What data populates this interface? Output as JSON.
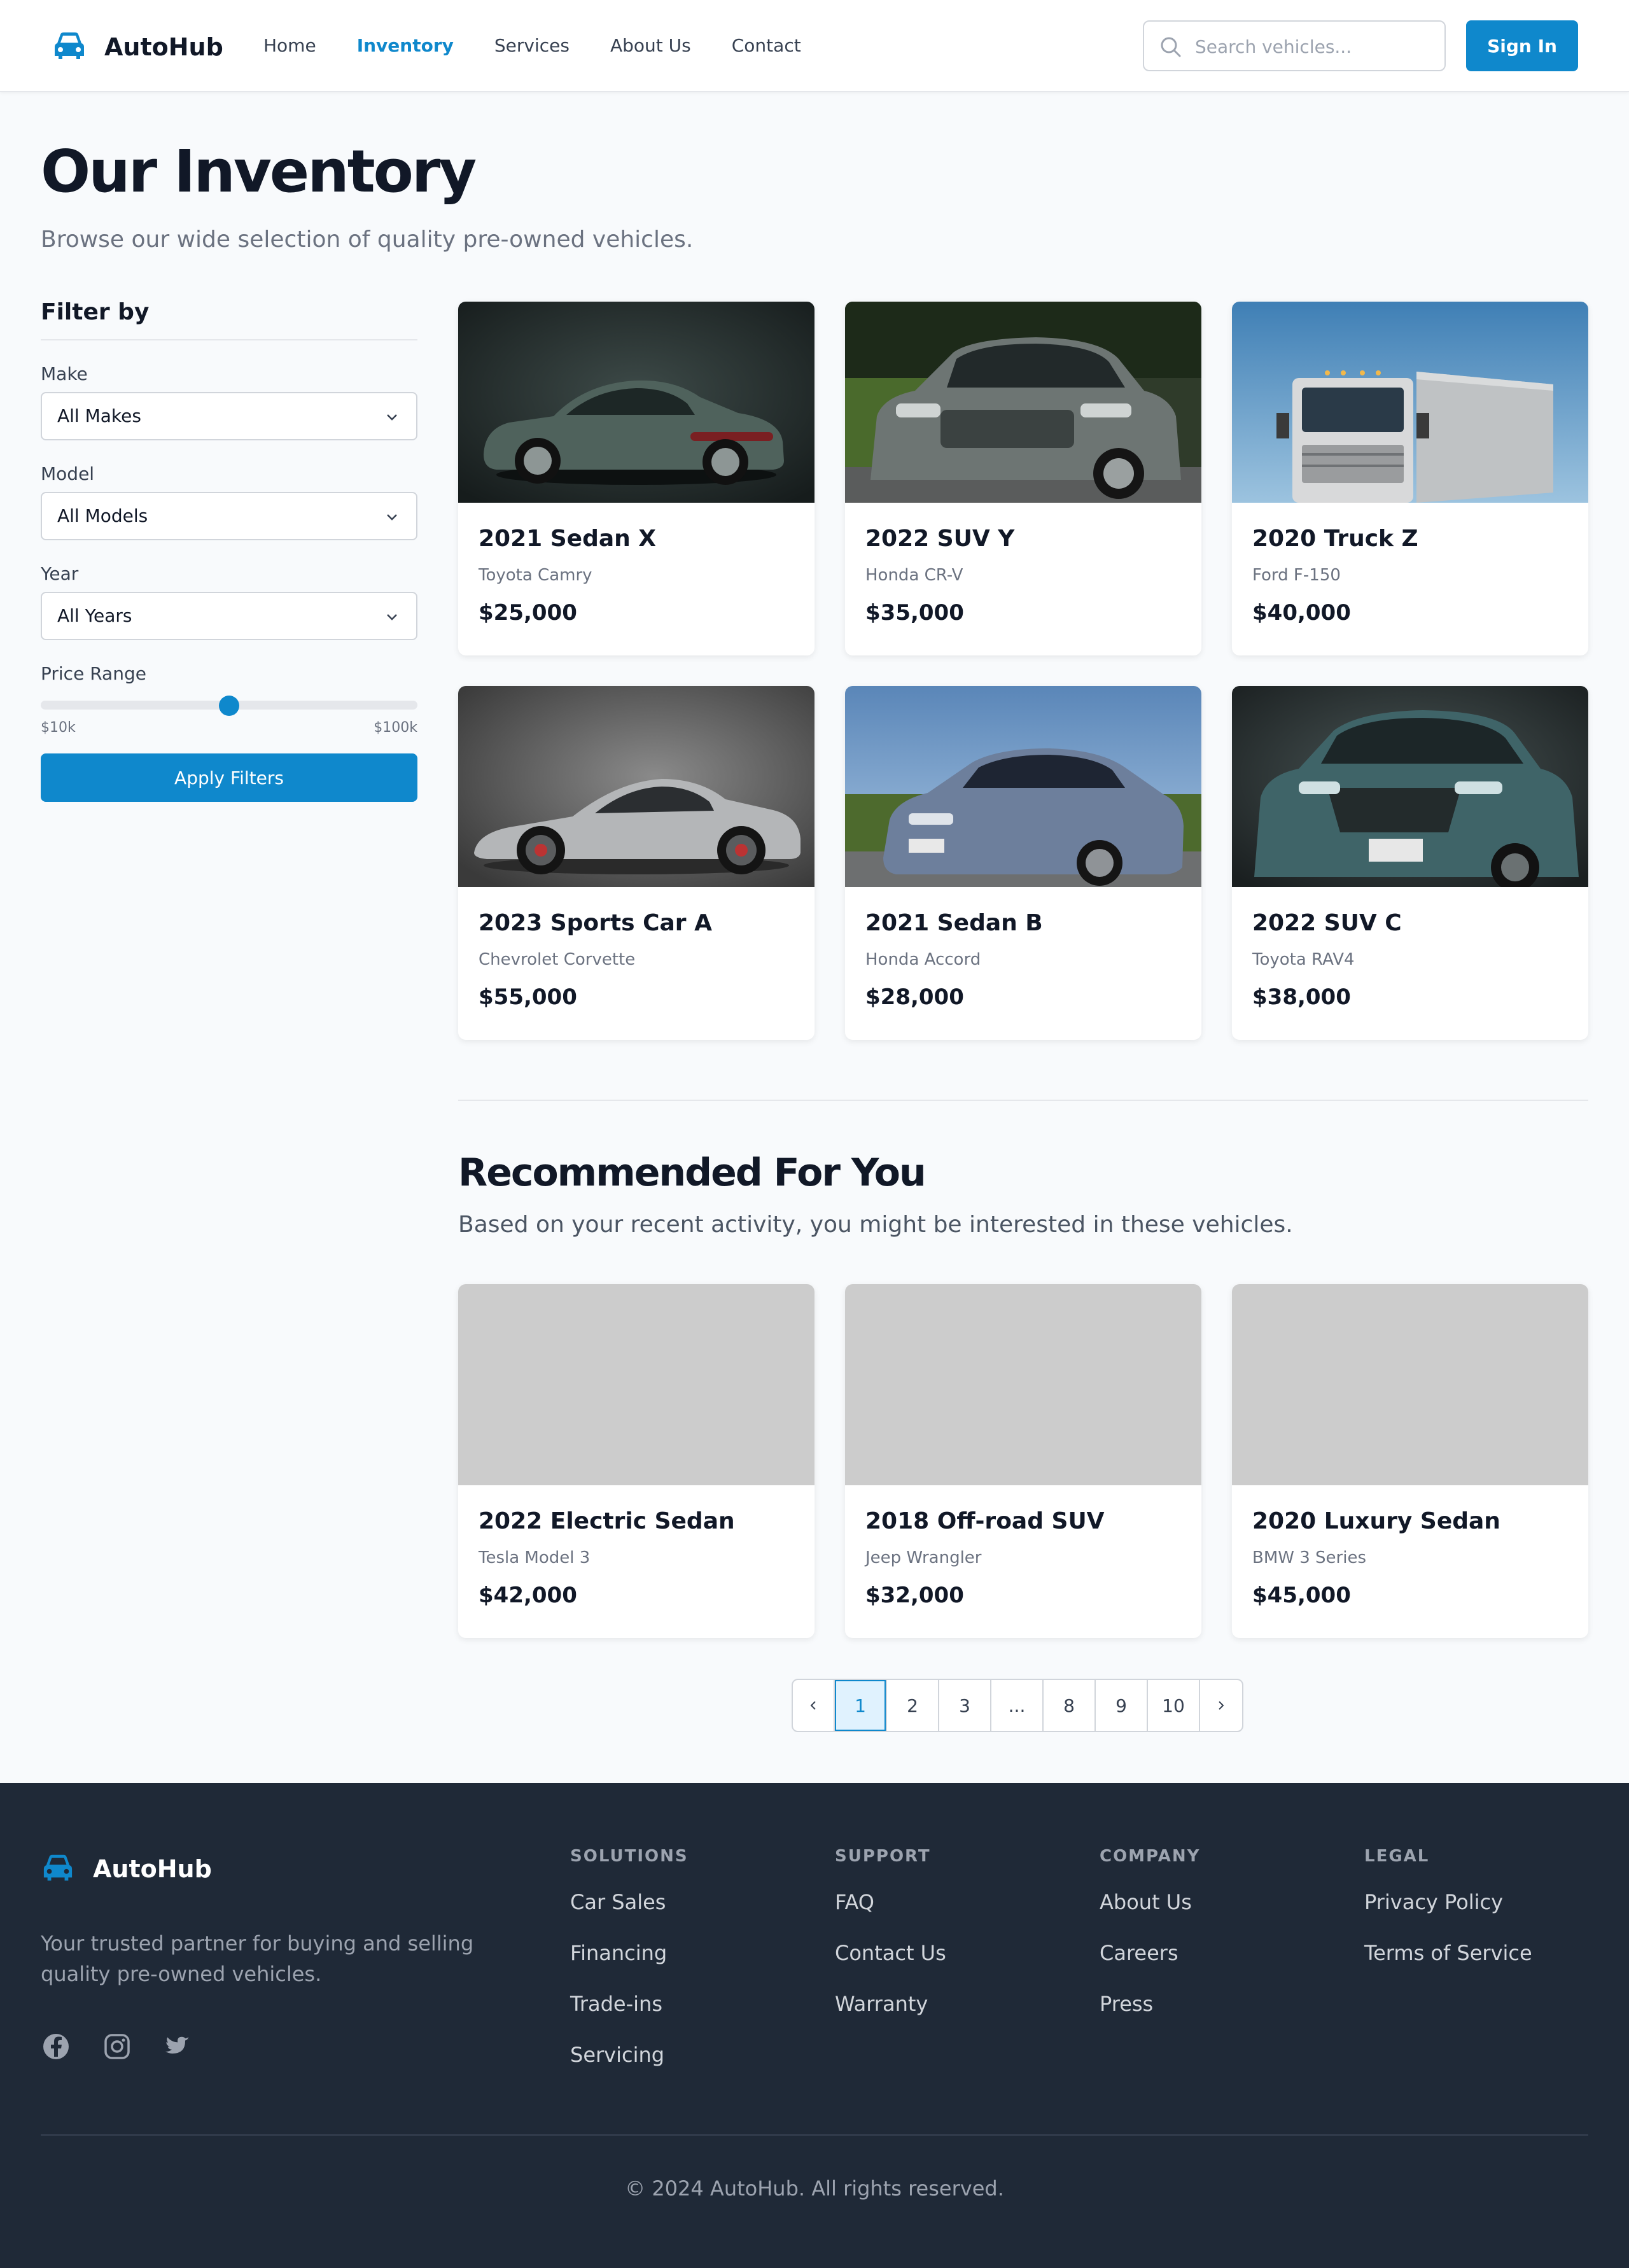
{
  "header": {
    "brand": "AutoHub",
    "nav": [
      "Home",
      "Inventory",
      "Services",
      "About Us",
      "Contact"
    ],
    "active_nav": "Inventory",
    "search_placeholder": "Search vehicles...",
    "signin_label": "Sign In"
  },
  "page": {
    "title": "Our Inventory",
    "subtitle": "Browse our wide selection of quality pre-owned vehicles."
  },
  "filters": {
    "heading": "Filter by",
    "make_label": "Make",
    "make_value": "All Makes",
    "model_label": "Model",
    "model_value": "All Models",
    "year_label": "Year",
    "year_value": "All Years",
    "price_label": "Price Range",
    "price_min": "$10k",
    "price_max": "$100k",
    "price_slider_fraction": 0.5,
    "apply_label": "Apply Filters"
  },
  "inventory": [
    {
      "title": "2021 Sedan X",
      "model": "Toyota Camry",
      "price": "$25,000"
    },
    {
      "title": "2022 SUV Y",
      "model": "Honda CR-V",
      "price": "$35,000"
    },
    {
      "title": "2020 Truck Z",
      "model": "Ford F-150",
      "price": "$40,000"
    },
    {
      "title": "2023 Sports Car A",
      "model": "Chevrolet Corvette",
      "price": "$55,000"
    },
    {
      "title": "2021 Sedan B",
      "model": "Honda Accord",
      "price": "$28,000"
    },
    {
      "title": "2022 SUV C",
      "model": "Toyota RAV4",
      "price": "$38,000"
    }
  ],
  "recommended": {
    "title": "Recommended For You",
    "subtitle": "Based on your recent activity, you might be interested in these vehicles.",
    "items": [
      {
        "title": "2022 Electric Sedan",
        "model": "Tesla Model 3",
        "price": "$42,000"
      },
      {
        "title": "2018 Off-road SUV",
        "model": "Jeep Wrangler",
        "price": "$32,000"
      },
      {
        "title": "2020 Luxury Sedan",
        "model": "BMW 3 Series",
        "price": "$45,000"
      }
    ]
  },
  "pagination": {
    "prev_icon": "chevron-left-icon",
    "pages": [
      "1",
      "2",
      "3",
      "...",
      "8",
      "9",
      "10"
    ],
    "current": "1",
    "next_icon": "chevron-right-icon"
  },
  "footer": {
    "brand": "AutoHub",
    "tagline": "Your trusted partner for buying and selling quality pre-owned vehicles.",
    "social_icons": [
      "facebook-icon",
      "instagram-icon",
      "twitter-icon"
    ],
    "columns": [
      {
        "title": "SOLUTIONS",
        "links": [
          "Car Sales",
          "Financing",
          "Trade-ins",
          "Servicing"
        ]
      },
      {
        "title": "SUPPORT",
        "links": [
          "FAQ",
          "Contact Us",
          "Warranty"
        ]
      },
      {
        "title": "COMPANY",
        "links": [
          "About Us",
          "Careers",
          "Press"
        ]
      },
      {
        "title": "LEGAL",
        "links": [
          "Privacy Policy",
          "Terms of Service"
        ]
      }
    ],
    "copyright": "© 2024 AutoHub. All rights reserved."
  },
  "colors": {
    "accent": "#0f88cc",
    "footer_bg": "#1f2937",
    "page_bg": "#f8fafc",
    "placeholder_image": "#cccccc"
  }
}
